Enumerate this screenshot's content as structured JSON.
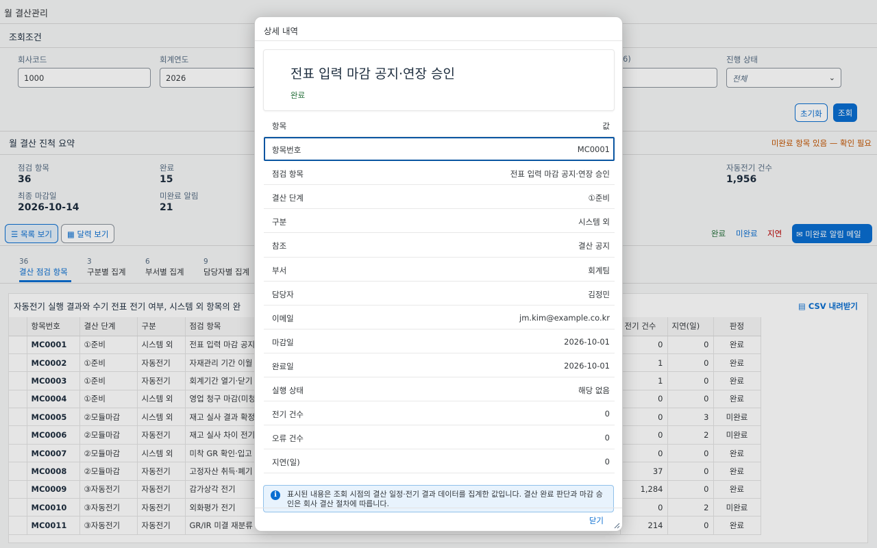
{
  "app": {
    "title": "월 결산관리"
  },
  "filters": {
    "section_title": "조회조건",
    "company_label": "회사코드",
    "company_value": "1000",
    "year_label": "회계연도",
    "year_value": "2026",
    "hidden_label_fragment": "6)",
    "status_label": "진행 상태",
    "status_value": "전체",
    "reset_label": "초기화",
    "search_label": "조회"
  },
  "summary": {
    "title": "월 결산 진척 요약",
    "warning": "미완료 항목 있음 — 확인 필요",
    "kpis": {
      "items_label": "점검 항목",
      "items_value": "36",
      "done_label": "완료",
      "done_value": "15",
      "deadline_label": "최종 마감일",
      "deadline_value": "2026-10-14",
      "alerts_label": "미완료 알림",
      "alerts_value": "21",
      "auto_label": "자동전기 건수",
      "auto_value": "1,956"
    }
  },
  "view": {
    "list_label": "목록 보기",
    "calendar_label": "달력 보기"
  },
  "legend": {
    "done": "완료",
    "undone": "미완료",
    "delayed": "지연"
  },
  "mail_button": "미완료 알림 메일",
  "tabs": [
    {
      "count": "36",
      "label": "결산 점검 항목"
    },
    {
      "count": "3",
      "label": "구분별 집계"
    },
    {
      "count": "6",
      "label": "부서별 집계"
    },
    {
      "count": "9",
      "label": "담당자별 집계"
    }
  ],
  "table": {
    "heading": "자동전기 실행 결과와 수기 전표 전기 여부, 시스템 외 항목의 완",
    "csv_label": "CSV 내려받기",
    "columns": [
      "항목번호",
      "결산 단계",
      "구분",
      "점검 항목",
      "전기 건수",
      "지연(일)",
      "판정"
    ],
    "rows": [
      {
        "id": "MC0001",
        "stage": "①준비",
        "type": "시스템 외",
        "item": "전표 입력 마감 공지",
        "posted": "0",
        "delay": "0",
        "result": "완료",
        "ok": true
      },
      {
        "id": "MC0002",
        "stage": "①준비",
        "type": "자동전기",
        "item": "자재관리 기간 이월",
        "posted": "1",
        "delay": "0",
        "result": "완료",
        "ok": true
      },
      {
        "id": "MC0003",
        "stage": "①준비",
        "type": "자동전기",
        "item": "회계기간 열기·닫기",
        "posted": "1",
        "delay": "0",
        "result": "완료",
        "ok": true
      },
      {
        "id": "MC0004",
        "stage": "①준비",
        "type": "시스템 외",
        "item": "영업 청구 마감(미청",
        "posted": "0",
        "delay": "0",
        "result": "완료",
        "ok": true
      },
      {
        "id": "MC0005",
        "stage": "②모듈마감",
        "type": "시스템 외",
        "item": "재고 실사 결과 확정",
        "posted": "0",
        "delay": "3",
        "result": "미완료",
        "ok": false
      },
      {
        "id": "MC0006",
        "stage": "②모듈마감",
        "type": "자동전기",
        "item": "재고 실사 차이 전기",
        "posted": "0",
        "delay": "2",
        "result": "미완료",
        "ok": false
      },
      {
        "id": "MC0007",
        "stage": "②모듈마감",
        "type": "시스템 외",
        "item": "미착 GR 확인·입고",
        "posted": "0",
        "delay": "0",
        "result": "완료",
        "ok": true
      },
      {
        "id": "MC0008",
        "stage": "②모듈마감",
        "type": "자동전기",
        "item": "고정자산 취득·폐기",
        "posted": "37",
        "delay": "0",
        "result": "완료",
        "ok": true
      },
      {
        "id": "MC0009",
        "stage": "③자동전기",
        "type": "자동전기",
        "item": "감가상각 전기",
        "posted": "1,284",
        "delay": "0",
        "result": "완료",
        "ok": true
      },
      {
        "id": "MC0010",
        "stage": "③자동전기",
        "type": "자동전기",
        "item": "외화평가 전기",
        "posted": "0",
        "delay": "2",
        "result": "미완료",
        "ok": false
      },
      {
        "id": "MC0011",
        "stage": "③자동전기",
        "type": "자동전기",
        "item": "GR/IR 미결 재분류",
        "posted": "214",
        "delay": "0",
        "result": "완료",
        "ok": true
      }
    ]
  },
  "dialog": {
    "title": "상세 내역",
    "object_title": "전표 입력 마감 공지·연장 승인",
    "object_status": "완료",
    "header_key": "항목",
    "header_value": "값",
    "fields": [
      {
        "k": "항목번호",
        "v": "MC0001"
      },
      {
        "k": "점검 항목",
        "v": "전표 입력 마감 공지·연장 승인"
      },
      {
        "k": "결산 단계",
        "v": "①준비"
      },
      {
        "k": "구분",
        "v": "시스템 외"
      },
      {
        "k": "참조",
        "v": "결산 공지"
      },
      {
        "k": "부서",
        "v": "회계팀"
      },
      {
        "k": "담당자",
        "v": "김정민"
      },
      {
        "k": "이메일",
        "v": "jm.kim@example.co.kr"
      },
      {
        "k": "마감일",
        "v": "2026-10-01"
      },
      {
        "k": "완료일",
        "v": "2026-10-01"
      },
      {
        "k": "실행 상태",
        "v": "해당 없음"
      },
      {
        "k": "전기 건수",
        "v": "0"
      },
      {
        "k": "오류 건수",
        "v": "0"
      },
      {
        "k": "지연(일)",
        "v": "0"
      }
    ],
    "info": "표시된 내용은 조회 시점의 결산 일정·전기 결과 데이터를 집계한 값입니다. 결산 완료 판단과 마감 승인은 회사 결산 절차에 따릅니다.",
    "close_label": "닫기"
  },
  "colors": {
    "accent": "#0a6ed1",
    "positive": "#256f3a",
    "critical": "#c35500",
    "negative": "#bb0000"
  }
}
